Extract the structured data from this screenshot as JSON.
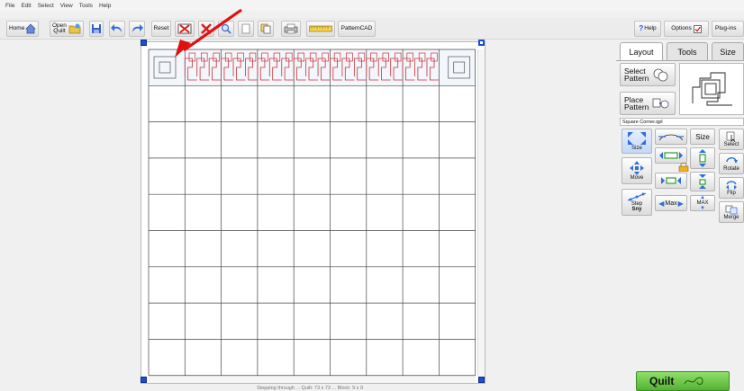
{
  "menu": [
    "File",
    "Edit",
    "Select",
    "View",
    "Tools",
    "Help"
  ],
  "toolbar": {
    "home": "Home",
    "open_quilt_1": "Open",
    "open_quilt_2": "Quilt",
    "reset": "Reset",
    "patterncad": "PatternCAD",
    "help": "Help",
    "options": "Options",
    "plugins": "Plug-ins"
  },
  "tabs": {
    "layout": "Layout",
    "tools": "Tools",
    "size": "Size"
  },
  "panel": {
    "select_pattern_1": "Select",
    "select_pattern_2": "Pattern",
    "place_pattern_1": "Place",
    "place_pattern_2": "Pattern",
    "pattern_name": "Square Corner.qpl",
    "size": "Size",
    "size_small": "Size",
    "move": "Move",
    "step": "Step",
    "step_sub": "Sny",
    "max": "Max",
    "max_right": "MAX",
    "select": "Select",
    "rotate": "Rotate",
    "flip": "Flip",
    "merge": "Merge"
  },
  "status_text": "Stepping through ... Quilt: 73 x 73 ... Block: 9 x 9",
  "quilt_button": "Quilt",
  "colors": {
    "accent": "#1b4fd8",
    "pattern": "#c8323c",
    "quilt_green": "#53b232",
    "arrow": "#e01010"
  }
}
